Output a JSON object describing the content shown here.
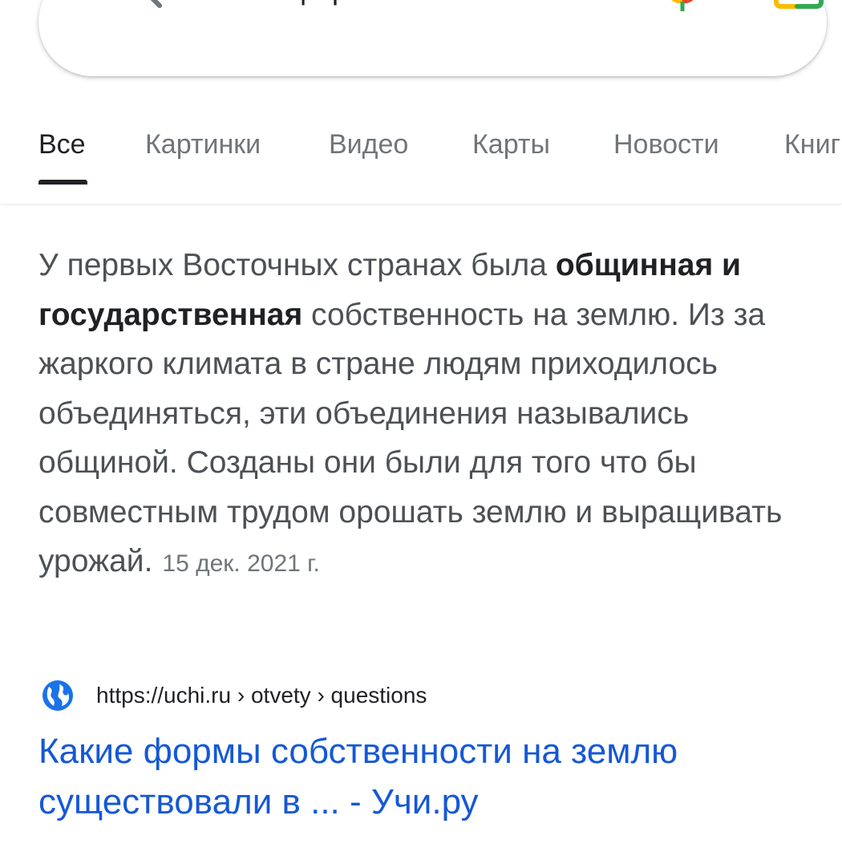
{
  "search": {
    "query": "Какие формы собственн..."
  },
  "icons": {
    "search": "search-icon",
    "mic": "mic-icon",
    "lens": "lens-camera-icon",
    "globe": "globe-icon"
  },
  "colors": {
    "link": "#1558d6",
    "text": "#202124",
    "muted": "#70757a",
    "google_blue": "#4285f4",
    "google_red": "#ea4335",
    "google_yellow": "#fbbc04",
    "google_green": "#34a853"
  },
  "tabs": [
    {
      "label": "Все",
      "active": true
    },
    {
      "label": "Картинки",
      "active": false
    },
    {
      "label": "Видео",
      "active": false
    },
    {
      "label": "Карты",
      "active": false
    },
    {
      "label": "Новости",
      "active": false
    },
    {
      "label": "Книги",
      "active": false
    }
  ],
  "snippet": {
    "text_before": "У первых Восточных странах была ",
    "bold": "общинная и государственная",
    "text_after": " собственность на землю. Из за жаркого климата в стране людям приходилось объединяться, эти объединения назывались общиной. Созданы они были для того что бы совместным трудом орошать землю и выращивать урожай.",
    "date": "15 дек. 2021 г."
  },
  "result": {
    "url": "https://uchi.ru › otvety › questions",
    "title": "Какие формы собственности на землю существовали в ... - Учи.ру"
  }
}
